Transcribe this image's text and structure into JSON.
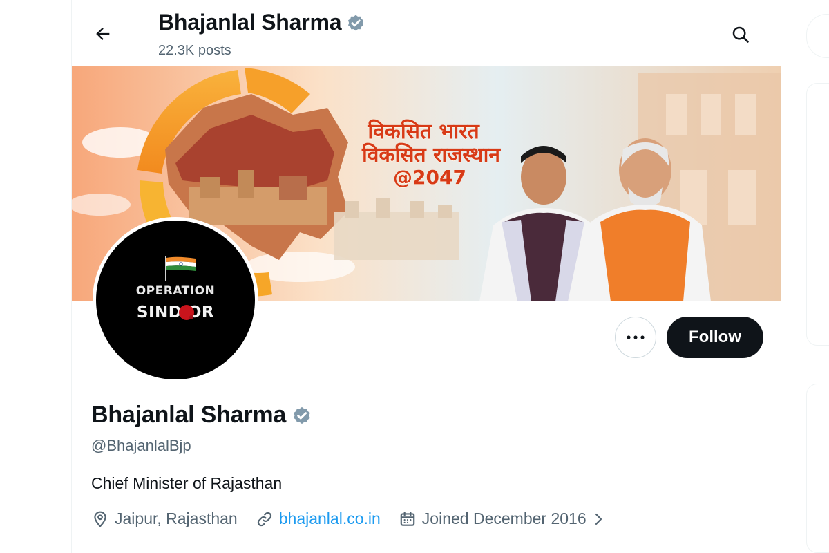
{
  "header": {
    "name": "Bhajanlal Sharma",
    "posts_count": "22.3K posts"
  },
  "banner": {
    "line1": "विकसित भारत",
    "line2": "विकसित राजस्थान",
    "line3": "@2047"
  },
  "avatar": {
    "operation_text": "OPERATION",
    "sindoor_text": "SIND  OR"
  },
  "actions": {
    "follow_label": "Follow"
  },
  "profile": {
    "name": "Bhajanlal Sharma",
    "handle": "@BhajanlalBjp",
    "bio": "Chief Minister of Rajasthan",
    "location": "Jaipur, Rajasthan",
    "website": "bhajanlal.co.in",
    "joined": "Joined December 2016"
  },
  "colors": {
    "verified_badge": "#829aab",
    "link": "#1d9bf0",
    "follow_bg": "#0f1419",
    "secondary_text": "#536471"
  },
  "icons": {
    "back": "arrow-left-icon",
    "search": "search-icon",
    "verified": "verified-badge-icon",
    "more": "more-dots-icon",
    "location": "location-pin-icon",
    "link": "link-icon",
    "calendar": "calendar-icon",
    "chevron": "chevron-right-icon"
  }
}
